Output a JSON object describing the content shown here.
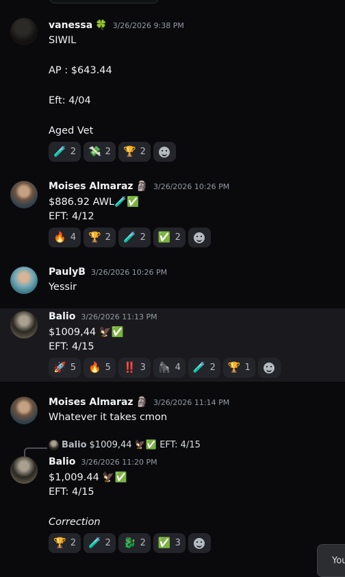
{
  "messages": [
    {
      "author": "vanessa",
      "badge": "🍀",
      "timestamp": "3/26/2026 9:38 PM",
      "lines": [
        "SIWIL",
        "AP : $643.44",
        "Eft: 4/04",
        "Aged Vet"
      ],
      "reactions": [
        {
          "emoji": "🧪",
          "count": "2"
        },
        {
          "emoji": "💸",
          "count": "2"
        },
        {
          "emoji": "🏆",
          "count": "2"
        }
      ]
    },
    {
      "author": "Moises Almaraz",
      "badge": "🗿",
      "timestamp": "3/26/2026 10:26 PM",
      "lines": [
        "$886.92 AWL🧪✅",
        "EFT: 4/12"
      ],
      "reactions": [
        {
          "emoji": "🔥",
          "count": "4"
        },
        {
          "emoji": "🏆",
          "count": "2"
        },
        {
          "emoji": "🧪",
          "count": "2"
        },
        {
          "emoji": "✅",
          "count": "2"
        }
      ]
    },
    {
      "author": "PaulyB",
      "timestamp": "3/26/2026 10:26 PM",
      "lines": [
        "Yessir"
      ]
    },
    {
      "author": "Balio",
      "timestamp": "3/26/2026 11:13 PM",
      "lines": [
        "$1009,44 🦅✅",
        "EFT: 4/15"
      ],
      "reactions": [
        {
          "emoji": "🚀",
          "count": "5"
        },
        {
          "emoji": "🔥",
          "count": "5"
        },
        {
          "emoji": "‼️",
          "count": "3"
        },
        {
          "emoji": "🦍",
          "count": "4"
        },
        {
          "emoji": "🧪",
          "count": "2"
        },
        {
          "emoji": "🏆",
          "count": "1"
        }
      ]
    },
    {
      "author": "Moises Almaraz",
      "badge": "🗿",
      "timestamp": "3/26/2026 11:14 PM",
      "lines": [
        "Whatever it takes cmon"
      ]
    },
    {
      "reply_to": {
        "author": "Balio",
        "text": "$1009,44 🦅✅ EFT: 4/15"
      },
      "author": "Balio",
      "timestamp": "3/26/2026 11:20 PM",
      "lines": [
        "$1,009.44 🦅✅",
        "EFT: 4/15",
        "Correction"
      ],
      "reactions": [
        {
          "emoji": "🏆",
          "count": "2"
        },
        {
          "emoji": "🧪",
          "count": "2"
        },
        {
          "emoji": "🐉",
          "count": "2"
        },
        {
          "emoji": "✅",
          "count": "3"
        }
      ]
    }
  ],
  "tooltip": {
    "text": "You"
  }
}
